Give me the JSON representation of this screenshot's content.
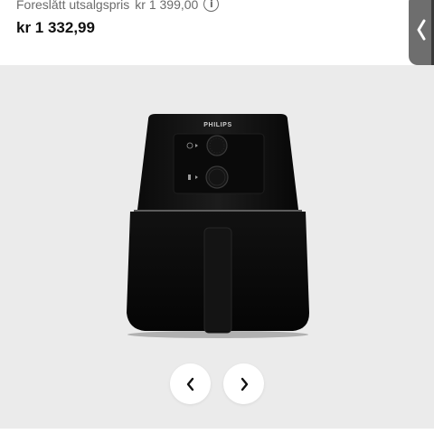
{
  "pricing": {
    "suggested_label": "Foreslått utsalgspris",
    "suggested_price": "kr 1 399,00",
    "info_symbol": "i",
    "current_price": "kr 1 332,99"
  },
  "product": {
    "brand": "PHILIPS"
  },
  "gallery": {
    "background": "#ebebeb",
    "prev_icon": "chevron-left-icon",
    "next_icon": "chevron-right-icon"
  },
  "side_tab": {
    "icon": "chevron-left-icon",
    "color": "#6e6e6e"
  }
}
